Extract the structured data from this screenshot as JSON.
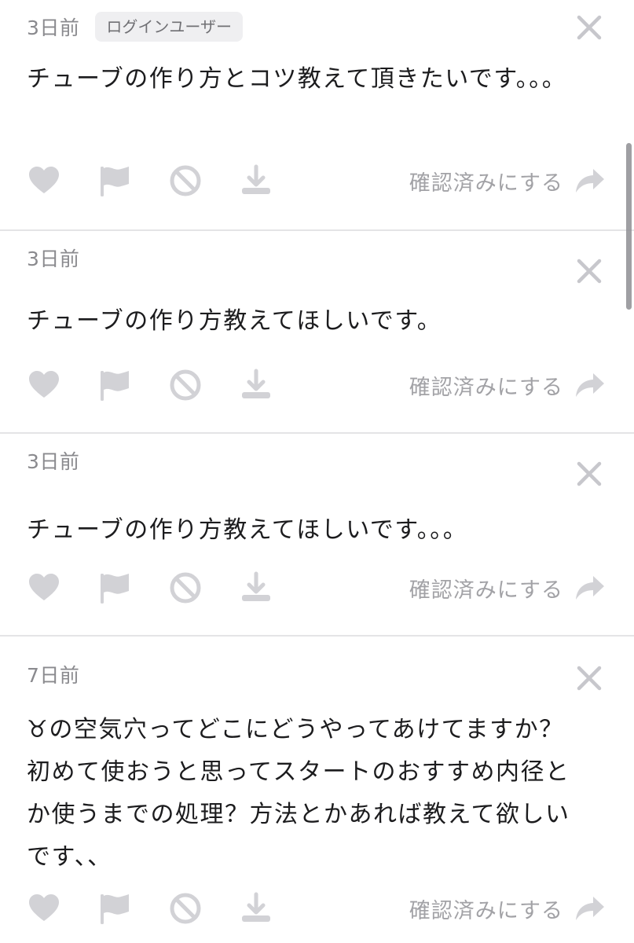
{
  "colors": {
    "icon": "#d2d2d6",
    "text": "#1c1c1e",
    "meta": "#8a8a8e",
    "divider": "#e4e4e6"
  },
  "action_labels": {
    "confirm": "確認済みにする"
  },
  "posts": [
    {
      "time": "3日前",
      "badge": "ログインユーザー",
      "body": "チューブの作り方とコツ教えて頂きたいです。。。"
    },
    {
      "time": "3日前",
      "badge": "",
      "body": "チューブの作り方教えてほしいです。"
    },
    {
      "time": "3日前",
      "badge": "",
      "body": "チューブの作り方教えてほしいです。。。"
    },
    {
      "time": "7日前",
      "badge": "",
      "body": "♉の空気穴ってどこにどうやってあけてますか？初めて使おうと思ってスタートのおすすめ内径とか使うまでの処理？方法とかあれば教えて欲しいです、、"
    }
  ],
  "icons": {
    "close": "close-icon",
    "like": "heart-icon",
    "flag": "flag-icon",
    "block": "block-icon",
    "download": "download-icon",
    "share": "share-arrow-icon"
  }
}
